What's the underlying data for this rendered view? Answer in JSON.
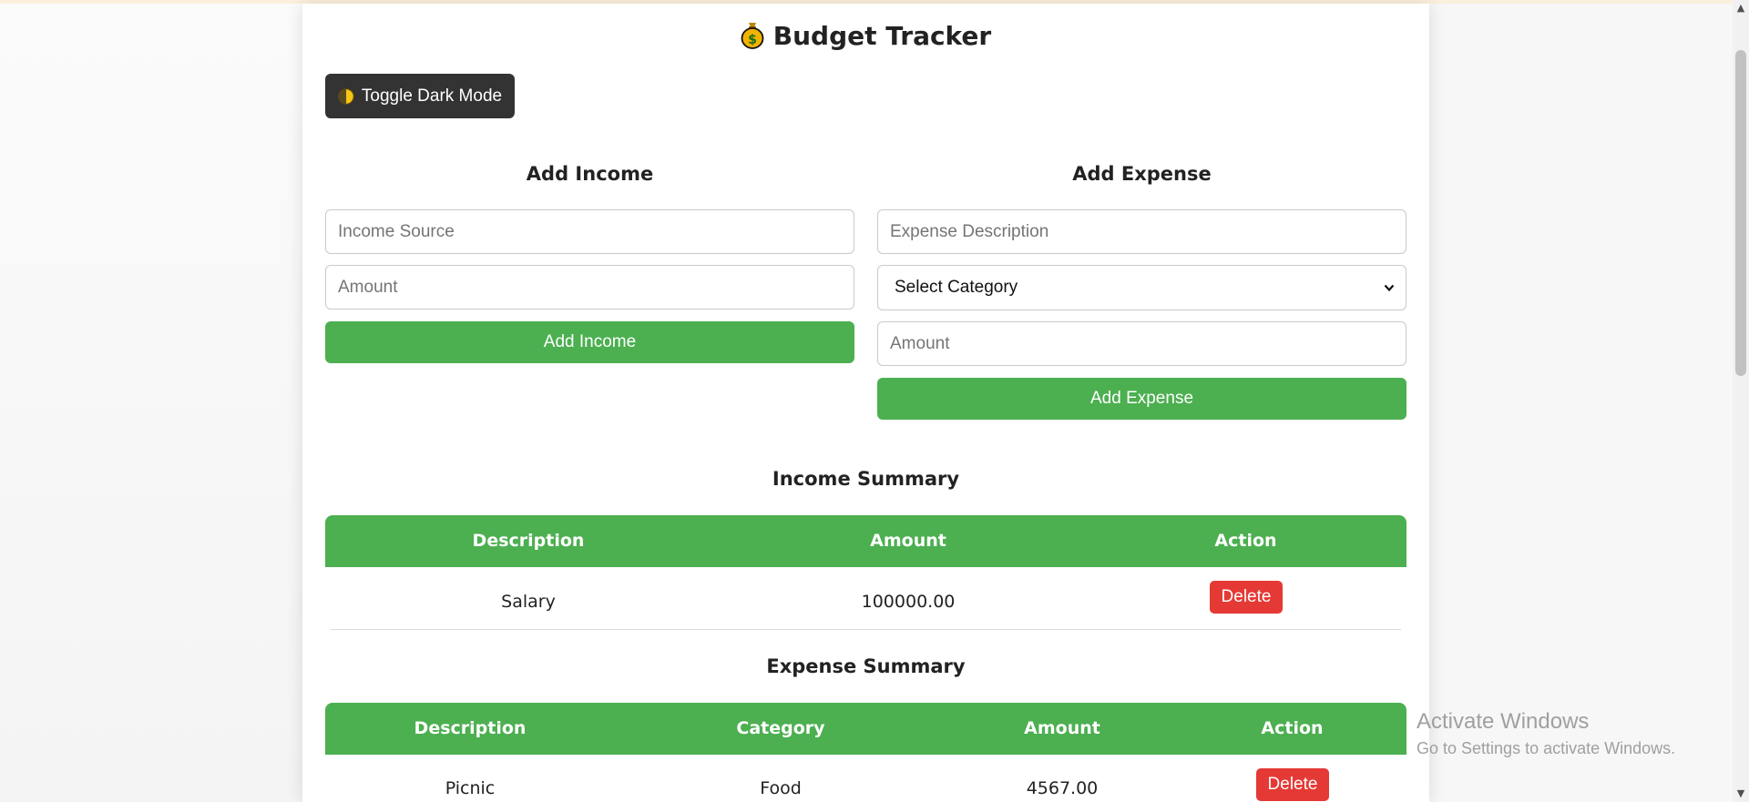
{
  "app": {
    "title": "Budget Tracker",
    "title_icon": "money-bag-icon",
    "dark_mode_button": "Toggle Dark Mode",
    "dark_mode_icon": "half-moon-icon"
  },
  "income_form": {
    "heading": "Add Income",
    "source_placeholder": "Income Source",
    "amount_placeholder": "Amount",
    "submit_label": "Add Income"
  },
  "expense_form": {
    "heading": "Add Expense",
    "description_placeholder": "Expense Description",
    "category_selected": "Select Category",
    "amount_placeholder": "Amount",
    "submit_label": "Add Expense"
  },
  "income_summary": {
    "heading": "Income Summary",
    "columns": [
      "Description",
      "Amount",
      "Action"
    ],
    "rows": [
      {
        "description": "Salary",
        "amount": "100000.00",
        "action": "Delete"
      }
    ]
  },
  "expense_summary": {
    "heading": "Expense Summary",
    "columns": [
      "Description",
      "Category",
      "Amount",
      "Action"
    ],
    "rows": [
      {
        "description": "Picnic",
        "category": "Food",
        "amount": "4567.00",
        "action": "Delete"
      }
    ]
  },
  "watermark": {
    "title": "Activate Windows",
    "subtitle": "Go to Settings to activate Windows."
  },
  "colors": {
    "accent_green": "#4caf50",
    "delete_red": "#e53935",
    "dark_button": "#333333"
  }
}
